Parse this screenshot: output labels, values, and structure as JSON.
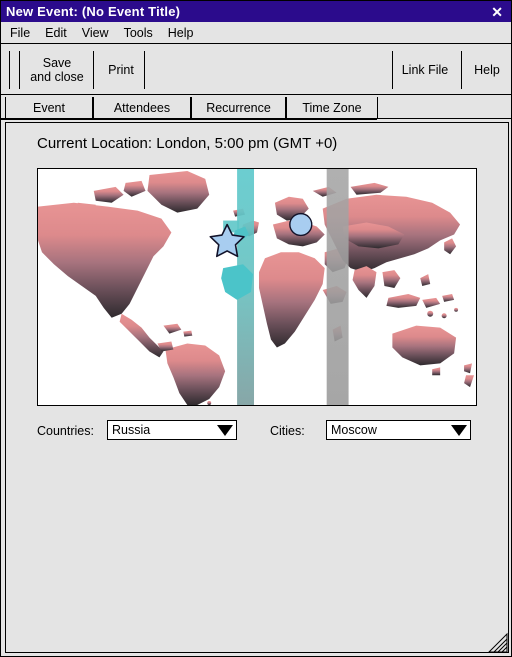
{
  "window": {
    "title": "New Event: (No Event Title)",
    "close_label": "✕",
    "titlebar_color": "#2b0b8c"
  },
  "menubar": {
    "items": [
      {
        "label": "File"
      },
      {
        "label": "Edit"
      },
      {
        "label": "View"
      },
      {
        "label": "Tools"
      },
      {
        "label": "Help"
      }
    ]
  },
  "toolbar": {
    "save_and_close_label": "Save\nand close",
    "print_label": "Print",
    "link_file_label": "Link File",
    "help_label": "Help"
  },
  "tabs": [
    {
      "label": "Event",
      "selected": true
    },
    {
      "label": "Attendees",
      "selected": false
    },
    {
      "label": "Recurrence",
      "selected": false
    },
    {
      "label": "Time Zone",
      "selected": false
    }
  ],
  "timezone_panel": {
    "heading": "Current Location: London, 5:00 pm (GMT +0)",
    "current_city": "London",
    "current_time": "5:00 pm",
    "current_offset": "GMT +0",
    "countries_label": "Countries:",
    "countries_value": "Russia",
    "cities_label": "Cities:",
    "cities_value": "Moscow",
    "map": {
      "land_color_north": "#e08b8b",
      "land_color_south": "#3b3034",
      "ocean_color": "#ffffff",
      "selected_band_color": "#4fc3c7",
      "other_band_color": "#a0a0a0",
      "home_marker": "star-marker",
      "home_marker_color": "#a8cdf0",
      "selected_marker": "circle-marker",
      "selected_marker_color": "#a8cdf0"
    }
  },
  "statusbar": {
    "resize_grip": "resize-grip-icon"
  }
}
